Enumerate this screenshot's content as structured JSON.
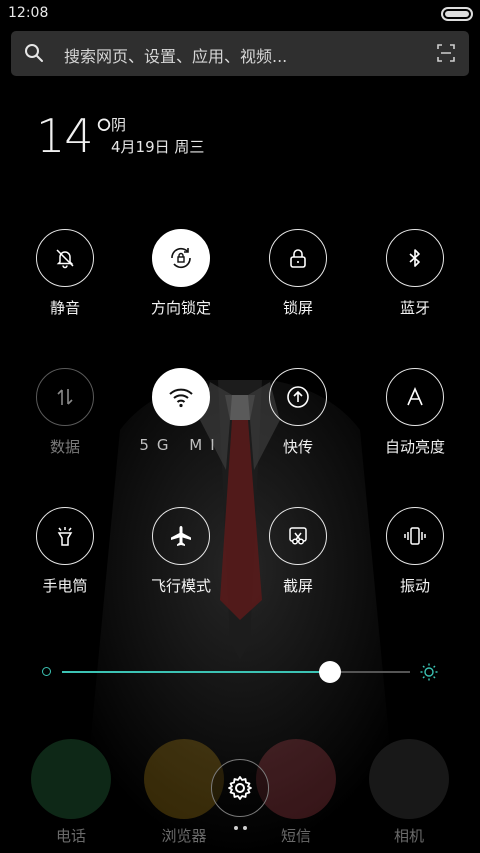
{
  "status_bar": {
    "time": "12:08"
  },
  "search": {
    "placeholder": "搜索网页、设置、应用、视频..."
  },
  "weather": {
    "temperature": "14°",
    "condition": "阴",
    "date": "4月19日 周三"
  },
  "toggles": [
    {
      "label": "静音",
      "icon": "bell-off-icon",
      "state": "off"
    },
    {
      "label": "方向锁定",
      "icon": "rotation-lock-icon",
      "state": "on"
    },
    {
      "label": "锁屏",
      "icon": "lock-icon",
      "state": "off"
    },
    {
      "label": "蓝牙",
      "icon": "bluetooth-icon",
      "state": "off"
    },
    {
      "label": "数据",
      "icon": "data-arrows-icon",
      "state": "disabled"
    },
    {
      "label": "",
      "sublabel": "5G MI",
      "icon": "wifi-icon",
      "state": "on"
    },
    {
      "label": "快传",
      "icon": "share-upload-icon",
      "state": "off"
    },
    {
      "label": "自动亮度",
      "icon": "auto-brightness-icon",
      "state": "off"
    },
    {
      "label": "手电筒",
      "icon": "flashlight-icon",
      "state": "off"
    },
    {
      "label": "飞行模式",
      "icon": "airplane-icon",
      "state": "off"
    },
    {
      "label": "截屏",
      "icon": "screenshot-scissors-icon",
      "state": "off"
    },
    {
      "label": "振动",
      "icon": "vibrate-icon",
      "state": "off"
    }
  ],
  "brightness": {
    "level": 0.77,
    "accent": "#3cc3b4"
  },
  "dock": [
    {
      "label": "电话",
      "icon": "phone-icon",
      "color": "#3fb56b"
    },
    {
      "label": "浏览器",
      "icon": "browser-icon",
      "color": "#f2b51d"
    },
    {
      "label": "短信",
      "icon": "message-icon",
      "color": "#f05a6a"
    },
    {
      "label": "相机",
      "icon": "camera-icon",
      "color": "#6c6c6c"
    }
  ],
  "settings": {
    "icon": "gear-icon"
  }
}
